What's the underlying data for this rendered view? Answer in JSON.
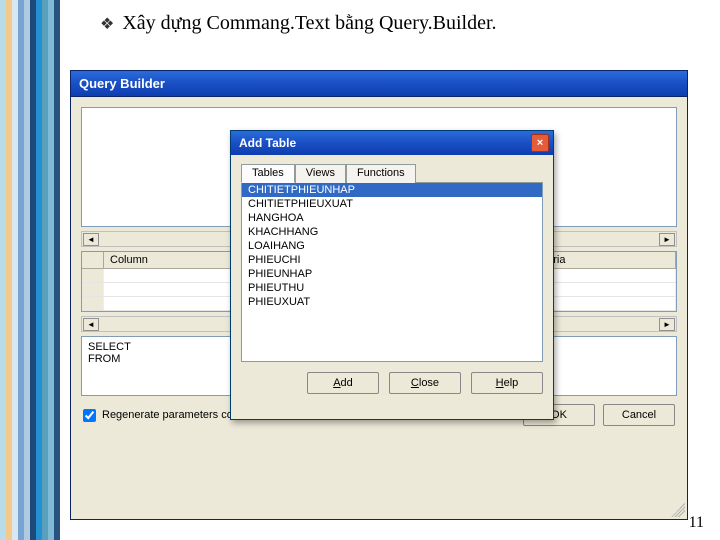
{
  "slide": {
    "title": "Xây dựng Commang.Text bằng Query.Builder.",
    "page_number": "11"
  },
  "query_builder": {
    "title": "Query Builder",
    "grid": {
      "columns": [
        "Column",
        "Criteria"
      ]
    },
    "sql": "SELECT\nFROM",
    "checkbox_label": "Regenerate parameters collection for this command.",
    "buttons": {
      "ok": "OK",
      "cancel": "Cancel"
    }
  },
  "add_table": {
    "title": "Add Table",
    "tabs": [
      "Tables",
      "Views",
      "Functions"
    ],
    "items": [
      "CHITIETPHIEUNHAP",
      "CHITIETPHIEUXUAT",
      "HANGHOA",
      "KHACHHANG",
      "LOAIHANG",
      "PHIEUCHI",
      "PHIEUNHAP",
      "PHIEUTHU",
      "PHIEUXUAT"
    ],
    "selected_index": 0,
    "buttons": {
      "add": "Add",
      "close": "Close",
      "help": "Help"
    }
  }
}
